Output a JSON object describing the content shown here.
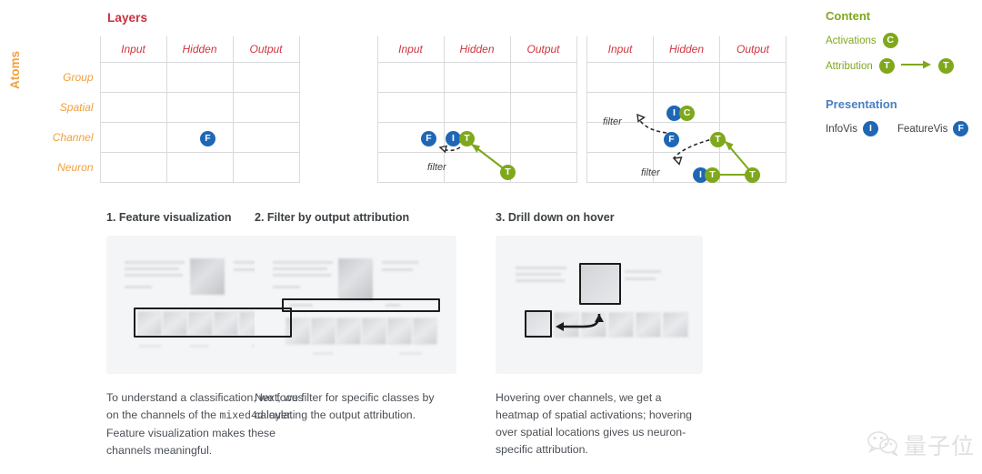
{
  "matrix": {
    "col_axis_title": "Layers",
    "row_axis_title": "Atoms",
    "columns": [
      "Input",
      "Hidden",
      "Output"
    ],
    "rows": [
      "Group",
      "Spatial",
      "Channel",
      "Neuron"
    ],
    "filter_label": "filter",
    "panels": [
      {
        "name": "matrix-1",
        "badges": [
          {
            "text": "F",
            "color": "blue",
            "row": "Channel",
            "col": "Hidden"
          }
        ]
      },
      {
        "name": "matrix-2",
        "badges": [
          {
            "text": "F",
            "color": "blue",
            "row": "Channel",
            "col": "Hidden"
          },
          {
            "text": "I",
            "color": "blue",
            "row": "Channel",
            "col": "Hidden"
          },
          {
            "text": "T",
            "color": "green",
            "row": "Channel",
            "col": "Hidden"
          },
          {
            "text": "T",
            "color": "green",
            "row": "Neuron",
            "col": "Output"
          }
        ]
      },
      {
        "name": "matrix-3",
        "badges": [
          {
            "text": "I",
            "color": "blue",
            "row": "Spatial",
            "col": "Hidden"
          },
          {
            "text": "C",
            "color": "green",
            "row": "Spatial",
            "col": "Hidden"
          },
          {
            "text": "F",
            "color": "blue",
            "row": "Channel",
            "col": "Hidden"
          },
          {
            "text": "T",
            "color": "green",
            "row": "Channel",
            "col": "Output"
          },
          {
            "text": "I",
            "color": "blue",
            "row": "Neuron",
            "col": "Hidden"
          },
          {
            "text": "T",
            "color": "green",
            "row": "Neuron",
            "col": "Hidden"
          },
          {
            "text": "T",
            "color": "green",
            "row": "Neuron",
            "col": "Output"
          }
        ]
      }
    ]
  },
  "legend": {
    "content": {
      "title": "Content",
      "activations_label": "Activations",
      "activations_badge": "C",
      "attribution_label": "Attribution",
      "attribution_badge_from": "T",
      "attribution_badge_to": "T"
    },
    "presentation": {
      "title": "Presentation",
      "infovis_label": "InfoVis",
      "infovis_badge": "I",
      "featurevis_label": "FeatureVis",
      "featurevis_badge": "F"
    }
  },
  "steps": [
    {
      "title": "1. Feature visualization",
      "caption_pre": "To understand a classification, we focus on the channels of the ",
      "caption_mono": "mixed4d",
      "caption_post": " layer. Feature visualization makes these channels meaningful."
    },
    {
      "title": "2. Filter by output attribution",
      "caption_pre": "Next, we filter for specific classes by calculating the output attribution.",
      "caption_mono": "",
      "caption_post": ""
    },
    {
      "title": "3. Drill down on hover",
      "caption_pre": "Hovering over channels, we get a heatmap of spatial activations; hovering over spatial locations gives us neuron-specific attribution.",
      "caption_mono": "",
      "caption_post": ""
    }
  ],
  "watermark": {
    "text": "量子位"
  },
  "colors": {
    "red": "#c9303c",
    "orange": "#f2a03d",
    "green": "#7fa81c",
    "blue": "#1f67b5",
    "legend_blue": "#4a7fbf",
    "grid": "#d8dade",
    "text": "#4a4f55"
  }
}
